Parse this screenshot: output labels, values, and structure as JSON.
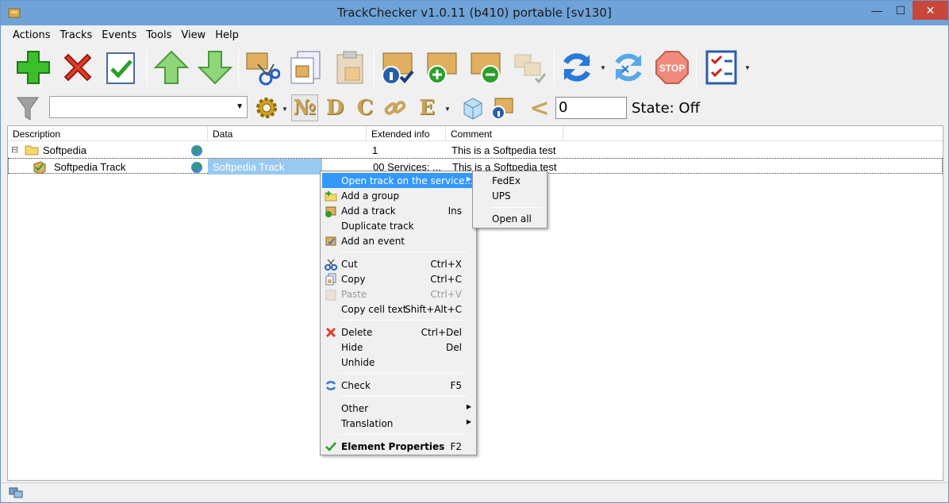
{
  "window": {
    "title": "TrackChecker v1.0.11 (b410)  portable [sv130]",
    "min_glyph": "—",
    "max_glyph": "☐",
    "close_glyph": "✕"
  },
  "menubar": [
    "Actions",
    "Tracks",
    "Events",
    "Tools",
    "View",
    "Help"
  ],
  "toolbar": {
    "icons": [
      "add-icon",
      "delete-icon",
      "check-icon",
      "move-up-icon",
      "move-down-icon",
      "cut-icon",
      "copy-icon",
      "paste-icon",
      "properties-icon",
      "add-group-icon",
      "remove-group-icon",
      "events-icon",
      "check-refresh-icon",
      "check-all-icon",
      "stop-icon",
      "checklist-icon"
    ],
    "stop_label": "STOP"
  },
  "filterbar": {
    "filter_value": "",
    "letters": [
      "№",
      "D",
      "C",
      "E"
    ],
    "less_than": "<",
    "number_value": "0",
    "state_label": "State: Off"
  },
  "grid": {
    "columns": [
      "Description",
      "Data",
      "Extended info",
      "Comment"
    ],
    "rows": [
      {
        "expander": "⊟",
        "description": "Softpedia",
        "data": "",
        "extended": "1",
        "comment": "This is a Softpedia test"
      },
      {
        "expander": "",
        "description": "Softpedia Track",
        "data": "Softpedia Track",
        "extended": "00 Services: ...",
        "comment": "This is a Softpedia test"
      }
    ]
  },
  "context_menu": {
    "items": [
      {
        "label": "Open track on the service...",
        "shortcut": "",
        "submenu": "▶",
        "icon": ""
      },
      {
        "label": "Add a group",
        "shortcut": "",
        "icon": "add-group-icon"
      },
      {
        "label": "Add a track",
        "shortcut": "Ins",
        "icon": "add-track-icon"
      },
      {
        "label": "Duplicate track",
        "shortcut": "",
        "icon": ""
      },
      {
        "label": "Add an event",
        "shortcut": "",
        "icon": "add-event-icon"
      },
      {
        "label": "Cut",
        "shortcut": "Ctrl+X",
        "icon": "cut-icon"
      },
      {
        "label": "Copy",
        "shortcut": "Ctrl+C",
        "icon": "copy-icon"
      },
      {
        "label": "Paste",
        "shortcut": "Ctrl+V",
        "icon": "paste-icon"
      },
      {
        "label": "Copy cell text",
        "shortcut": "Shift+Alt+C",
        "icon": ""
      },
      {
        "label": "Delete",
        "shortcut": "Ctrl+Del",
        "icon": "delete-icon"
      },
      {
        "label": "Hide",
        "shortcut": "Del",
        "icon": ""
      },
      {
        "label": "Unhide",
        "shortcut": "",
        "icon": ""
      },
      {
        "label": "Check",
        "shortcut": "F5",
        "icon": "check-icon"
      },
      {
        "label": "Other",
        "shortcut": "",
        "submenu": "▶",
        "icon": ""
      },
      {
        "label": "Translation",
        "shortcut": "",
        "submenu": "▶",
        "icon": ""
      },
      {
        "label": "Element Properties",
        "shortcut": "F2",
        "icon": "checkmark-icon"
      }
    ]
  },
  "submenu": {
    "items": [
      "FedEx",
      "UPS",
      "Open all"
    ]
  },
  "colors": {
    "titlebar": "#6ea2d9",
    "close_button": "#c7473b",
    "menu_highlight": "#3399ff",
    "row_highlight": "#99c9ef"
  }
}
